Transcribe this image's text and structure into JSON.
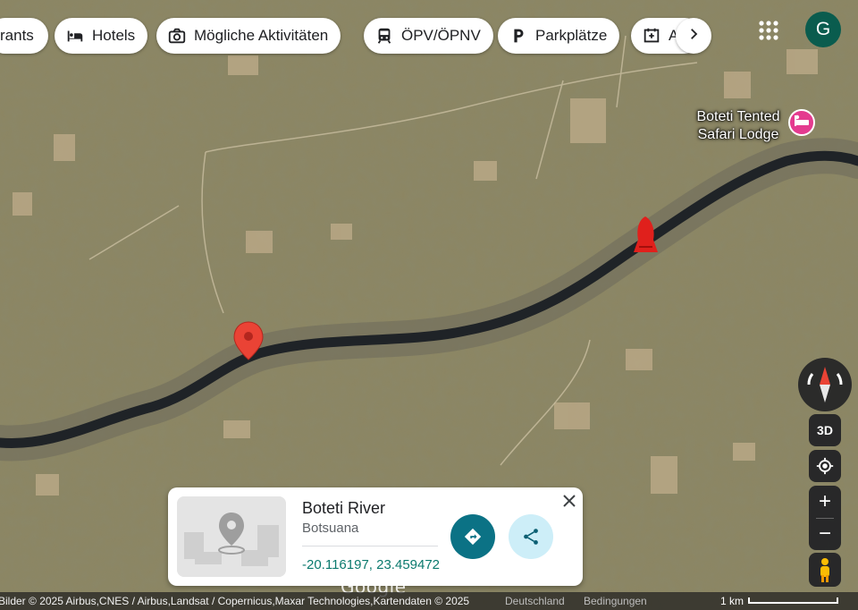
{
  "chips": [
    {
      "label": "rants",
      "icon": "restaurant-icon"
    },
    {
      "label": "Hotels",
      "icon": "bed-icon"
    },
    {
      "label": "Mögliche Aktivitäten",
      "icon": "camera-icon"
    },
    {
      "label": "ÖPV/ÖPNV",
      "icon": "train-icon"
    },
    {
      "label": "Parkplätze",
      "icon": "parking-icon"
    },
    {
      "label": "Ap",
      "icon": "pharmacy-icon"
    }
  ],
  "account": {
    "initial": "G"
  },
  "poi": {
    "name": "Boteti Tented Safari Lodge",
    "icon": "hotel-icon",
    "color": "#e43b8f"
  },
  "controls": {
    "three_d": "3D",
    "zoom_in": "+",
    "zoom_out": "−"
  },
  "card": {
    "title": "Boteti River",
    "subtitle": "Botsuana",
    "coordinates": "-20.116197, 23.459472"
  },
  "footer": {
    "attribution": "Bilder © 2025 Airbus,CNES / Airbus,Landsat / Copernicus,Maxar Technologies,Kartendaten © 2025",
    "country": "Deutschland",
    "terms": "Bedingungen",
    "scale": "1 km",
    "logo": "Google"
  },
  "colors": {
    "pin": "#ea4335",
    "accent": "#0b7285",
    "share_bg": "#cdeef8",
    "avatar": "#0a5c4e"
  }
}
